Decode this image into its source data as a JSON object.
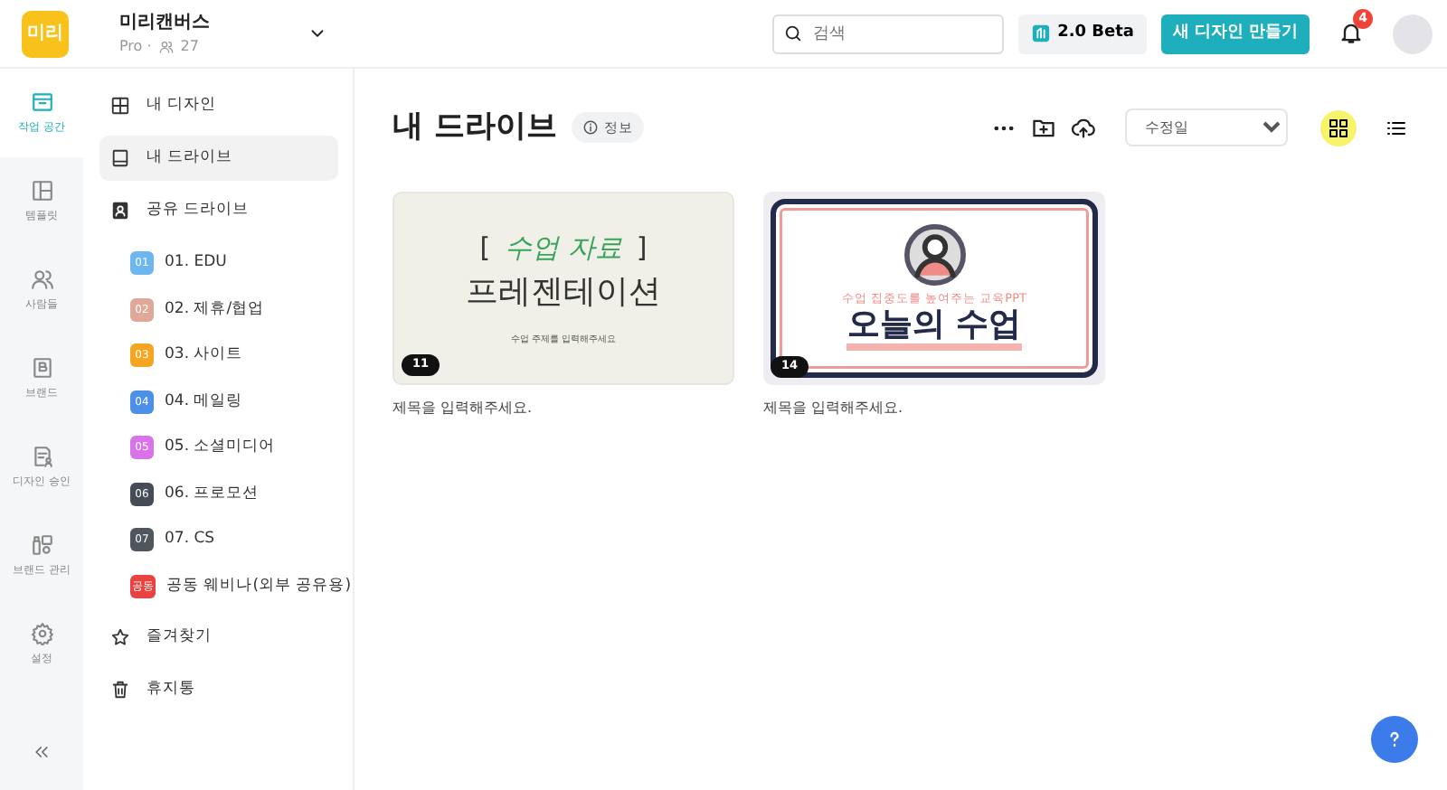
{
  "header": {
    "logo": "미리",
    "workspace": {
      "name": "미리캔버스",
      "plan": "Pro ·",
      "members": "27"
    },
    "search": {
      "placeholder": "검색"
    },
    "beta_button": "2.0 Beta",
    "create_button": "새 디자인 만들기",
    "notifications": "4"
  },
  "rail": {
    "items": [
      {
        "label": "작업 공간",
        "selected": true
      },
      {
        "label": "템플릿",
        "selected": false
      },
      {
        "label": "사람들",
        "selected": false
      },
      {
        "label": "브랜드",
        "selected": false
      },
      {
        "label": "디자인 승인",
        "selected": false
      },
      {
        "label": "브랜드 관리",
        "selected": false
      },
      {
        "label": "설정",
        "selected": false
      }
    ]
  },
  "sidebar": {
    "items": [
      {
        "label": "내 디자인",
        "selected": false
      },
      {
        "label": "내 드라이브",
        "selected": true
      },
      {
        "label": "공유 드라이브",
        "selected": false,
        "children": [
          {
            "badge": "01",
            "label": "01. EDU",
            "color": "#6db6ee",
            "selected": false
          },
          {
            "badge": "02",
            "label": "02. 제휴/협업",
            "color": "#dfa898",
            "selected": false
          },
          {
            "badge": "03",
            "label": "03. 사이트",
            "color": "#f5a51f",
            "selected": false
          },
          {
            "badge": "04",
            "label": "04. 메일링",
            "color": "#4c8fe6",
            "selected": false
          },
          {
            "badge": "05",
            "label": "05. 소셜미디어",
            "color": "#d873ea",
            "selected": false
          },
          {
            "badge": "06",
            "label": "06. 프로모션",
            "color": "#464c55",
            "selected": false
          },
          {
            "badge": "07",
            "label": "07. CS",
            "color": "#50565e",
            "selected": false
          },
          {
            "badge": "공동",
            "label": "공동 웨비나(외부 공유용)",
            "color": "#e9423f",
            "selected": false
          }
        ]
      },
      {
        "label": "즐겨찾기",
        "selected": false
      },
      {
        "label": "휴지통",
        "selected": false
      }
    ]
  },
  "main": {
    "title": "내 드라이브",
    "info": "정보",
    "sort": "수정일",
    "views": [
      {
        "selected": true
      },
      {
        "selected": false
      }
    ],
    "designs": [
      {
        "kind": "presentation",
        "pages": "11",
        "title": "제목을 입력해주세요.",
        "heading": [
          {
            "text": "[",
            "accent": false
          },
          {
            "text": "수업 자료",
            "accent": true
          },
          {
            "text": "]",
            "accent": false
          }
        ],
        "headline": "프레젠테이션",
        "subtitle": "수업 주제를 입력해주세요"
      },
      {
        "kind": "lesson",
        "pages": "14",
        "title": "제목을 입력해주세요.",
        "subtitle": "수업 집중도를 높여주는 교육PPT",
        "headline": "오늘의 수업"
      }
    ]
  }
}
